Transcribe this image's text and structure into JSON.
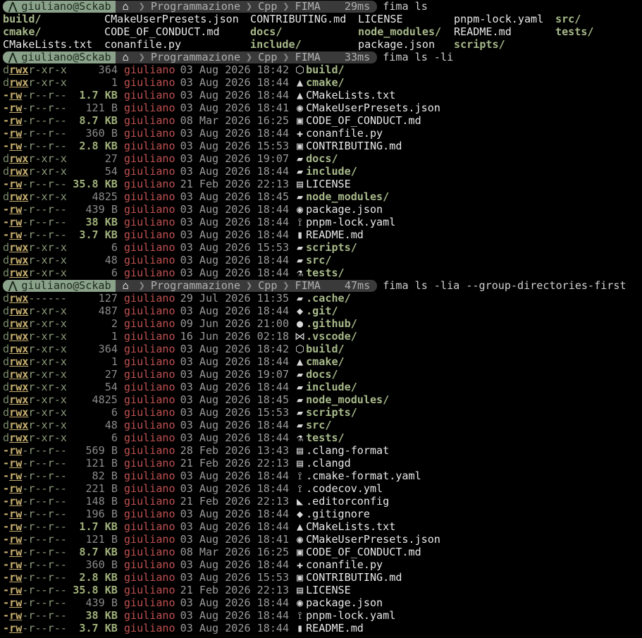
{
  "prompt": {
    "user": "giuliano@Sckab",
    "path": [
      "Programmazione",
      "Cpp",
      "FIMA"
    ]
  },
  "commands": [
    {
      "time": "29ms",
      "cmd": "fima ls"
    },
    {
      "time": "33ms",
      "cmd": "fima ls -li"
    },
    {
      "time": "47ms",
      "cmd": "fima ls -lia --group-directories-first"
    }
  ],
  "ls_grid": [
    [
      "build/",
      "CMakeUserPresets.json",
      "CONTRIBUTING.md",
      "LICENSE",
      "pnpm-lock.yaml",
      "src/"
    ],
    [
      "cmake/",
      "CODE_OF_CONDUCT.md",
      "docs/",
      "node_modules/",
      "README.md",
      "tests/"
    ],
    [
      "CMakeLists.txt",
      "conanfile.py",
      "include/",
      "package.json",
      "scripts/",
      ""
    ]
  ],
  "ls_grid_dirs": [
    "build/",
    "src/",
    "cmake/",
    "docs/",
    "node_modules/",
    "tests/",
    "include/",
    "scripts/"
  ],
  "listing1": [
    {
      "perm": "drwxr-xr-x",
      "size": "364",
      "bold": false,
      "user": "giuliano",
      "date": "03 Aug 2026 18:42",
      "icon": "cube-icon",
      "glyph": "⬡",
      "name": "build/",
      "dir": true
    },
    {
      "perm": "drwxr-xr-x",
      "size": "1",
      "bold": false,
      "user": "giuliano",
      "date": "03 Aug 2026 18:44",
      "icon": "triangle-icon",
      "glyph": "▲",
      "name": "cmake/",
      "dir": true
    },
    {
      "perm": "-rw-r--r--",
      "size": "1.7 KB",
      "bold": true,
      "user": "giuliano",
      "date": "03 Aug 2026 18:44",
      "icon": "triangle-icon",
      "glyph": "▲",
      "name": "CMakeLists.txt",
      "dir": false
    },
    {
      "perm": "-rw-r--r--",
      "size": "121 B",
      "bold": false,
      "user": "giuliano",
      "date": "03 Aug 2026 18:41",
      "icon": "json-icon",
      "glyph": "◉",
      "name": "CMakeUserPresets.json",
      "dir": false
    },
    {
      "perm": "-rw-r--r--",
      "size": "8.7 KB",
      "bold": true,
      "user": "giuliano",
      "date": "08 Mar 2026 16:25",
      "icon": "markdown-icon",
      "glyph": "▣",
      "name": "CODE_OF_CONDUCT.md",
      "dir": false
    },
    {
      "perm": "-rw-r--r--",
      "size": "360 B",
      "bold": false,
      "user": "giuliano",
      "date": "03 Aug 2026 18:44",
      "icon": "python-icon",
      "glyph": "✚",
      "name": "conanfile.py",
      "dir": false
    },
    {
      "perm": "-rw-r--r--",
      "size": "2.8 KB",
      "bold": true,
      "user": "giuliano",
      "date": "03 Aug 2026 15:53",
      "icon": "markdown-icon",
      "glyph": "▣",
      "name": "CONTRIBUTING.md",
      "dir": false
    },
    {
      "perm": "drwxr-xr-x",
      "size": "27",
      "bold": false,
      "user": "giuliano",
      "date": "03 Aug 2026 19:07",
      "icon": "folder-icon",
      "glyph": "▰",
      "name": "docs/",
      "dir": true
    },
    {
      "perm": "drwxr-xr-x",
      "size": "54",
      "bold": false,
      "user": "giuliano",
      "date": "03 Aug 2026 18:44",
      "icon": "folder-icon",
      "glyph": "▰",
      "name": "include/",
      "dir": true
    },
    {
      "perm": "-rw-r--r--",
      "size": "35.8 KB",
      "bold": true,
      "user": "giuliano",
      "date": "21 Feb 2026 22:13",
      "icon": "license-icon",
      "glyph": "▤",
      "name": "LICENSE",
      "dir": false
    },
    {
      "perm": "drwxr-xr-x",
      "size": "4825",
      "bold": false,
      "user": "giuliano",
      "date": "03 Aug 2026 18:45",
      "icon": "folder-icon",
      "glyph": "▰",
      "name": "node_modules/",
      "dir": true
    },
    {
      "perm": "-rw-r--r--",
      "size": "439 B",
      "bold": false,
      "user": "giuliano",
      "date": "03 Aug 2026 18:44",
      "icon": "json-icon",
      "glyph": "◉",
      "name": "package.json",
      "dir": false
    },
    {
      "perm": "-rw-r--r--",
      "size": "38 KB",
      "bold": true,
      "user": "giuliano",
      "date": "03 Aug 2026 18:44",
      "icon": "yaml-icon",
      "glyph": "⟟",
      "name": "pnpm-lock.yaml",
      "dir": false
    },
    {
      "perm": "-rw-r--r--",
      "size": "3.7 KB",
      "bold": true,
      "user": "giuliano",
      "date": "03 Aug 2026 18:44",
      "icon": "readme-icon",
      "glyph": "▮",
      "name": "README.md",
      "dir": false
    },
    {
      "perm": "drwxr-xr-x",
      "size": "6",
      "bold": false,
      "user": "giuliano",
      "date": "03 Aug 2026 15:53",
      "icon": "folder-icon",
      "glyph": "▰",
      "name": "scripts/",
      "dir": true
    },
    {
      "perm": "drwxr-xr-x",
      "size": "48",
      "bold": false,
      "user": "giuliano",
      "date": "03 Aug 2026 18:44",
      "icon": "folder-icon",
      "glyph": "▰",
      "name": "src/",
      "dir": true
    },
    {
      "perm": "drwxr-xr-x",
      "size": "6",
      "bold": false,
      "user": "giuliano",
      "date": "03 Aug 2026 18:44",
      "icon": "test-icon",
      "glyph": "⚗",
      "name": "tests/",
      "dir": true
    }
  ],
  "listing2": [
    {
      "perm": "drwx------",
      "size": "127",
      "bold": false,
      "user": "giuliano",
      "date": "29 Jul 2026 11:35",
      "icon": "folder-icon",
      "glyph": "▰",
      "name": ".cache/",
      "dir": true
    },
    {
      "perm": "drwxr-xr-x",
      "size": "487",
      "bold": false,
      "user": "giuliano",
      "date": "03 Aug 2026 18:44",
      "icon": "git-icon",
      "glyph": "◆",
      "name": ".git/",
      "dir": true
    },
    {
      "perm": "drwxr-xr-x",
      "size": "2",
      "bold": false,
      "user": "giuliano",
      "date": "09 Jun 2026 21:00",
      "icon": "github-icon",
      "glyph": "●",
      "name": ".github/",
      "dir": true
    },
    {
      "perm": "drwxr-xr-x",
      "size": "1",
      "bold": false,
      "user": "giuliano",
      "date": "16 Jun 2026 02:18",
      "icon": "vscode-icon",
      "glyph": "⋈",
      "name": ".vscode/",
      "dir": true
    },
    {
      "perm": "drwxr-xr-x",
      "size": "364",
      "bold": false,
      "user": "giuliano",
      "date": "03 Aug 2026 18:42",
      "icon": "cube-icon",
      "glyph": "⬡",
      "name": "build/",
      "dir": true
    },
    {
      "perm": "drwxr-xr-x",
      "size": "1",
      "bold": false,
      "user": "giuliano",
      "date": "03 Aug 2026 18:44",
      "icon": "triangle-icon",
      "glyph": "▲",
      "name": "cmake/",
      "dir": true
    },
    {
      "perm": "drwxr-xr-x",
      "size": "27",
      "bold": false,
      "user": "giuliano",
      "date": "03 Aug 2026 19:07",
      "icon": "folder-icon",
      "glyph": "▰",
      "name": "docs/",
      "dir": true
    },
    {
      "perm": "drwxr-xr-x",
      "size": "54",
      "bold": false,
      "user": "giuliano",
      "date": "03 Aug 2026 18:44",
      "icon": "folder-icon",
      "glyph": "▰",
      "name": "include/",
      "dir": true
    },
    {
      "perm": "drwxr-xr-x",
      "size": "4825",
      "bold": false,
      "user": "giuliano",
      "date": "03 Aug 2026 18:45",
      "icon": "folder-icon",
      "glyph": "▰",
      "name": "node_modules/",
      "dir": true
    },
    {
      "perm": "drwxr-xr-x",
      "size": "6",
      "bold": false,
      "user": "giuliano",
      "date": "03 Aug 2026 15:53",
      "icon": "folder-icon",
      "glyph": "▰",
      "name": "scripts/",
      "dir": true
    },
    {
      "perm": "drwxr-xr-x",
      "size": "48",
      "bold": false,
      "user": "giuliano",
      "date": "03 Aug 2026 18:44",
      "icon": "folder-icon",
      "glyph": "▰",
      "name": "src/",
      "dir": true
    },
    {
      "perm": "drwxr-xr-x",
      "size": "6",
      "bold": false,
      "user": "giuliano",
      "date": "03 Aug 2026 18:44",
      "icon": "test-icon",
      "glyph": "⚗",
      "name": "tests/",
      "dir": true
    },
    {
      "perm": "-rw-r--r--",
      "size": "569 B",
      "bold": false,
      "user": "giuliano",
      "date": "28 Feb 2026 13:43",
      "icon": "config-icon",
      "glyph": "▤",
      "name": ".clang-format",
      "dir": false
    },
    {
      "perm": "-rw-r--r--",
      "size": "121 B",
      "bold": false,
      "user": "giuliano",
      "date": "21 Feb 2026 22:13",
      "icon": "config-icon",
      "glyph": "▤",
      "name": ".clangd",
      "dir": false
    },
    {
      "perm": "-rw-r--r--",
      "size": "82 B",
      "bold": false,
      "user": "giuliano",
      "date": "03 Aug 2026 18:44",
      "icon": "yaml-icon",
      "glyph": "⟟",
      "name": ".cmake-format.yaml",
      "dir": false
    },
    {
      "perm": "-rw-r--r--",
      "size": "221 B",
      "bold": false,
      "user": "giuliano",
      "date": "03 Aug 2026 18:44",
      "icon": "yaml-icon",
      "glyph": "⟟",
      "name": ".codecov.yml",
      "dir": false
    },
    {
      "perm": "-rw-r--r--",
      "size": "148 B",
      "bold": false,
      "user": "giuliano",
      "date": "21 Feb 2026 22:13",
      "icon": "editorconfig-icon",
      "glyph": "◣",
      "name": ".editorconfig",
      "dir": false
    },
    {
      "perm": "-rw-r--r--",
      "size": "196 B",
      "bold": false,
      "user": "giuliano",
      "date": "03 Aug 2026 18:44",
      "icon": "git-icon",
      "glyph": "◆",
      "name": ".gitignore",
      "dir": false
    },
    {
      "perm": "-rw-r--r--",
      "size": "1.7 KB",
      "bold": true,
      "user": "giuliano",
      "date": "03 Aug 2026 18:44",
      "icon": "triangle-icon",
      "glyph": "▲",
      "name": "CMakeLists.txt",
      "dir": false
    },
    {
      "perm": "-rw-r--r--",
      "size": "121 B",
      "bold": false,
      "user": "giuliano",
      "date": "03 Aug 2026 18:41",
      "icon": "json-icon",
      "glyph": "◉",
      "name": "CMakeUserPresets.json",
      "dir": false
    },
    {
      "perm": "-rw-r--r--",
      "size": "8.7 KB",
      "bold": true,
      "user": "giuliano",
      "date": "08 Mar 2026 16:25",
      "icon": "markdown-icon",
      "glyph": "▣",
      "name": "CODE_OF_CONDUCT.md",
      "dir": false
    },
    {
      "perm": "-rw-r--r--",
      "size": "360 B",
      "bold": false,
      "user": "giuliano",
      "date": "03 Aug 2026 18:44",
      "icon": "python-icon",
      "glyph": "✚",
      "name": "conanfile.py",
      "dir": false
    },
    {
      "perm": "-rw-r--r--",
      "size": "2.8 KB",
      "bold": true,
      "user": "giuliano",
      "date": "03 Aug 2026 15:53",
      "icon": "markdown-icon",
      "glyph": "▣",
      "name": "CONTRIBUTING.md",
      "dir": false
    },
    {
      "perm": "-rw-r--r--",
      "size": "35.8 KB",
      "bold": true,
      "user": "giuliano",
      "date": "21 Feb 2026 22:13",
      "icon": "license-icon",
      "glyph": "▤",
      "name": "LICENSE",
      "dir": false
    },
    {
      "perm": "-rw-r--r--",
      "size": "439 B",
      "bold": false,
      "user": "giuliano",
      "date": "03 Aug 2026 18:44",
      "icon": "json-icon",
      "glyph": "◉",
      "name": "package.json",
      "dir": false
    },
    {
      "perm": "-rw-r--r--",
      "size": "38 KB",
      "bold": true,
      "user": "giuliano",
      "date": "03 Aug 2026 18:44",
      "icon": "yaml-icon",
      "glyph": "⟟",
      "name": "pnpm-lock.yaml",
      "dir": false
    },
    {
      "perm": "-rw-r--r--",
      "size": "3.7 KB",
      "bold": true,
      "user": "giuliano",
      "date": "03 Aug 2026 18:44",
      "icon": "readme-icon",
      "glyph": "▮",
      "name": "README.md",
      "dir": false
    }
  ],
  "colors": {
    "background": "#000000",
    "prompt_user_bg": "#8aa18a",
    "prompt_path_bg": "#3a3a3a",
    "owner": "#c05050",
    "dir_name": "#a7b98a",
    "perm_highlight": "#c8b070"
  }
}
